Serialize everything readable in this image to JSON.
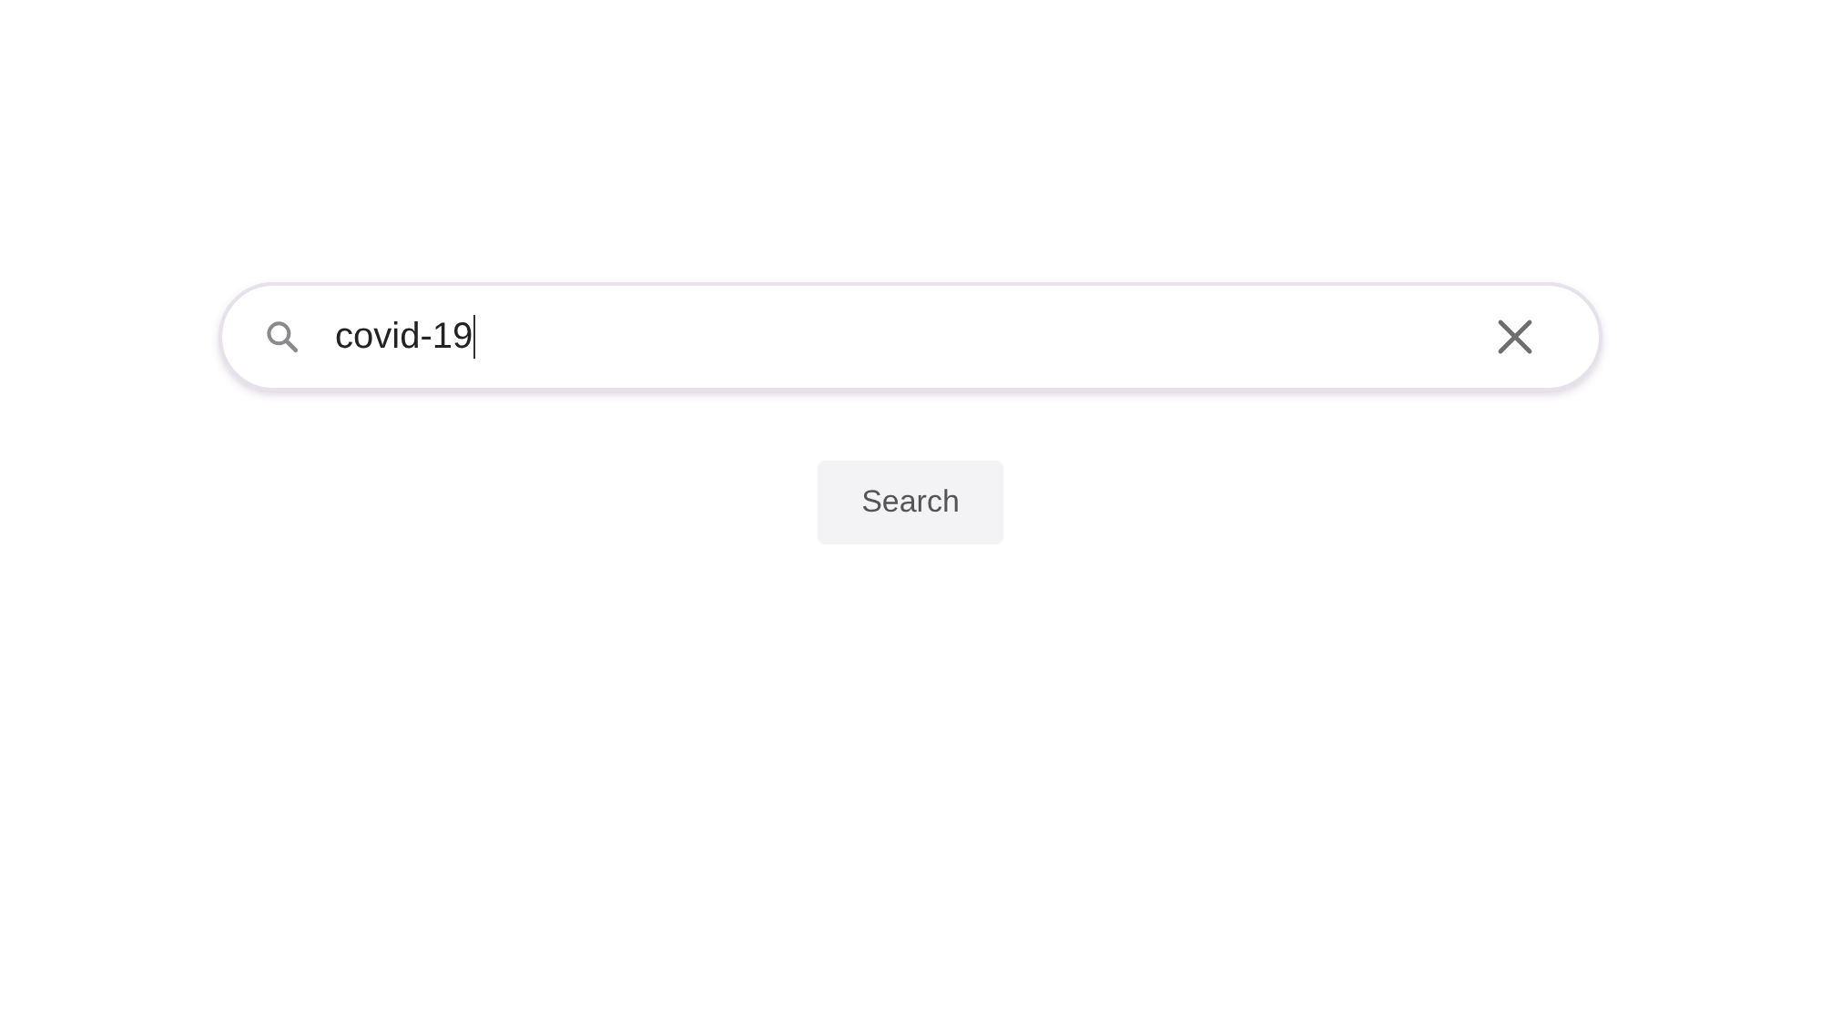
{
  "search": {
    "value": "covid-19"
  },
  "buttons": [
    "Search"
  ]
}
